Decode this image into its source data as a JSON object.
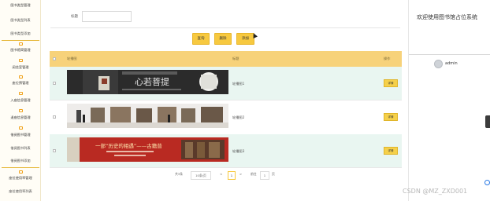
{
  "sidebar": {
    "items": [
      {
        "label": "图书类型管理"
      },
      {
        "label": "图书类型列表"
      },
      {
        "label": "图书类型添加"
      },
      {
        "label": "图书馆简管理"
      },
      {
        "label": "阅览室管理"
      },
      {
        "label": "座位预管理"
      },
      {
        "label": "入座信息管理"
      },
      {
        "label": "退座信息管理"
      },
      {
        "label": "借阅图书管理"
      },
      {
        "label": "借阅图书列表"
      },
      {
        "label": "借阅图书添加"
      },
      {
        "label": "座位使用率管理"
      },
      {
        "label": "座位使用率列表"
      }
    ]
  },
  "search": {
    "label": "标题",
    "value": ""
  },
  "toolbar": {
    "search_label": "查询",
    "delete_label": "删除",
    "add_label": "添加"
  },
  "table": {
    "columns": {
      "image": "轮播图",
      "title": "标题",
      "action": "操作"
    },
    "rows": [
      {
        "title": "轮播图1",
        "action": "详情",
        "banner_text": "心若菩提"
      },
      {
        "title": "轮播图2",
        "action": "详情"
      },
      {
        "title": "轮播图3",
        "action": "详情",
        "banner_text": "一部“历史的相遇”——古籍普"
      }
    ]
  },
  "pagination": {
    "total": "共3条",
    "page_size": "10条/页",
    "prev": "<",
    "current": "1",
    "next": ">",
    "goto_label": "前往",
    "goto_value": "1",
    "goto_suffix": "页"
  },
  "right_panel": {
    "welcome": "欢迎使用图书馆占位系统",
    "username": "admin"
  },
  "watermark": "CSDN @MZ_ZXD001",
  "colors": {
    "accent": "#f7c940",
    "header": "#f7d27a",
    "row_alt": "#e9f6f1"
  }
}
